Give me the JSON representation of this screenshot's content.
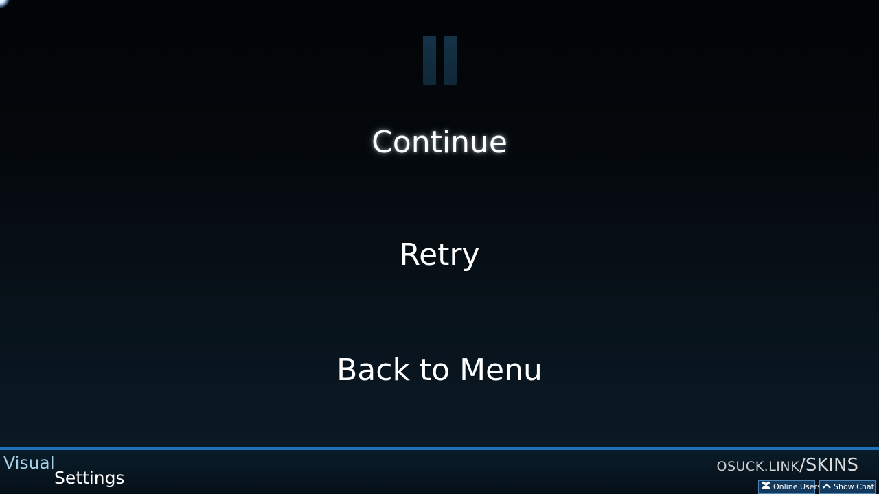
{
  "pause_menu": {
    "continue_label": "Continue",
    "retry_label": "Retry",
    "back_label": "Back to Menu"
  },
  "footer": {
    "visual_label_top": "Visual",
    "visual_label_bottom": "Settings",
    "skins_link_prefix": "OSUCK.LINK",
    "skins_link_slash_suffix": "/SKINS",
    "online_users_label": "Online Users",
    "show_chat_label": "Show Chat"
  },
  "icons": {
    "pause": "pause-icon",
    "cursor": "cursor-icon",
    "users": "users-icon",
    "chevron": "chevron-up-icon"
  },
  "colors": {
    "accent_line": "#1f72b8",
    "chip_bg": "#133a5c",
    "visual_text": "#a8cfe8"
  }
}
